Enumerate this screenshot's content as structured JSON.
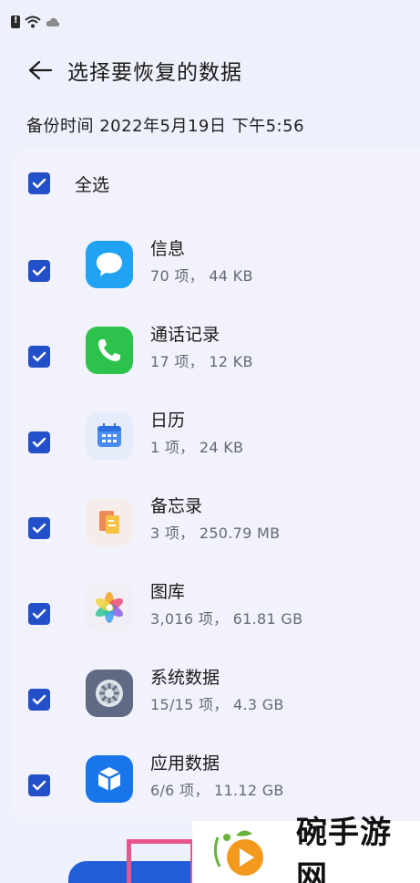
{
  "header": {
    "title": "选择要恢复的数据",
    "back_icon": "arrow-left-icon"
  },
  "backup_time": "备份时间 2022年5月19日 下午5:56",
  "select_all": {
    "label": "全选",
    "checked": true
  },
  "items": [
    {
      "name": "信息",
      "meta": "70 项， 44 KB",
      "icon": "messages-icon",
      "checked": true
    },
    {
      "name": "通话记录",
      "meta": "17 项， 12 KB",
      "icon": "phone-icon",
      "checked": true
    },
    {
      "name": "日历",
      "meta": "1 项， 24 KB",
      "icon": "calendar-icon",
      "checked": true
    },
    {
      "name": "备忘录",
      "meta": "3 项， 250.79 MB",
      "icon": "notes-icon",
      "checked": true
    },
    {
      "name": "图库",
      "meta": "3,016 项， 61.81 GB",
      "icon": "gallery-icon",
      "checked": true
    },
    {
      "name": "系统数据",
      "meta": "15/15 项， 4.3 GB",
      "icon": "system-data-icon",
      "checked": true
    },
    {
      "name": "应用数据",
      "meta": "6/6 项， 11.12 GB",
      "icon": "app-data-icon",
      "checked": true
    }
  ],
  "watermark": {
    "text": "碗手游网"
  },
  "colors": {
    "accent": "#2350c9",
    "background": "#eef0fb"
  }
}
